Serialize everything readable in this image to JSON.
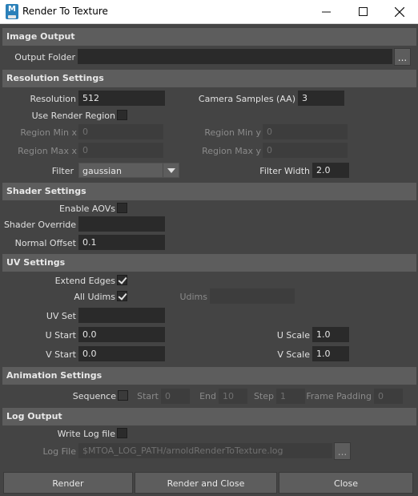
{
  "window": {
    "title": "Render To Texture",
    "app_icon_letter": "M"
  },
  "sections": {
    "image_output": "Image Output",
    "resolution_settings": "Resolution Settings",
    "shader_settings": "Shader Settings",
    "uv_settings": "UV Settings",
    "animation_settings": "Animation Settings",
    "log_output": "Log Output"
  },
  "image_output": {
    "output_folder_label": "Output Folder",
    "output_folder_value": "",
    "browse_label": "..."
  },
  "resolution": {
    "resolution_label": "Resolution",
    "resolution_value": "512",
    "camera_samples_label": "Camera Samples (AA)",
    "camera_samples_value": "3",
    "use_render_region_label": "Use Render Region",
    "use_render_region_checked": false,
    "region_min_x_label": "Region Min x",
    "region_min_x_value": "0",
    "region_min_y_label": "Region Min y",
    "region_min_y_value": "0",
    "region_max_x_label": "Region Max x",
    "region_max_x_value": "0",
    "region_max_y_label": "Region Max y",
    "region_max_y_value": "0",
    "filter_label": "Filter",
    "filter_value": "gaussian",
    "filter_width_label": "Filter Width",
    "filter_width_value": "2.0"
  },
  "shader": {
    "enable_aovs_label": "Enable AOVs",
    "enable_aovs_checked": false,
    "shader_override_label": "Shader Override",
    "shader_override_value": "",
    "normal_offset_label": "Normal Offset",
    "normal_offset_value": "0.1"
  },
  "uv": {
    "extend_edges_label": "Extend Edges",
    "extend_edges_checked": true,
    "all_udims_label": "All Udims",
    "all_udims_checked": true,
    "udims_label": "Udims",
    "udims_value": "",
    "uv_set_label": "UV Set",
    "uv_set_value": "",
    "u_start_label": "U Start",
    "u_start_value": "0.0",
    "u_scale_label": "U Scale",
    "u_scale_value": "1.0",
    "v_start_label": "V Start",
    "v_start_value": "0.0",
    "v_scale_label": "V Scale",
    "v_scale_value": "1.0"
  },
  "animation": {
    "sequence_label": "Sequence",
    "sequence_checked": false,
    "start_label": "Start",
    "start_value": "0",
    "end_label": "End",
    "end_value": "10",
    "step_label": "Step",
    "step_value": "1",
    "frame_padding_label": "Frame Padding",
    "frame_padding_value": "0"
  },
  "log": {
    "write_log_label": "Write Log file",
    "write_log_checked": false,
    "log_file_label": "Log File",
    "log_file_value": "$MTOA_LOG_PATH/arnoldRenderToTexture.log",
    "browse_label": "..."
  },
  "footer": {
    "render_label": "Render",
    "render_close_label": "Render and Close",
    "close_label": "Close"
  }
}
